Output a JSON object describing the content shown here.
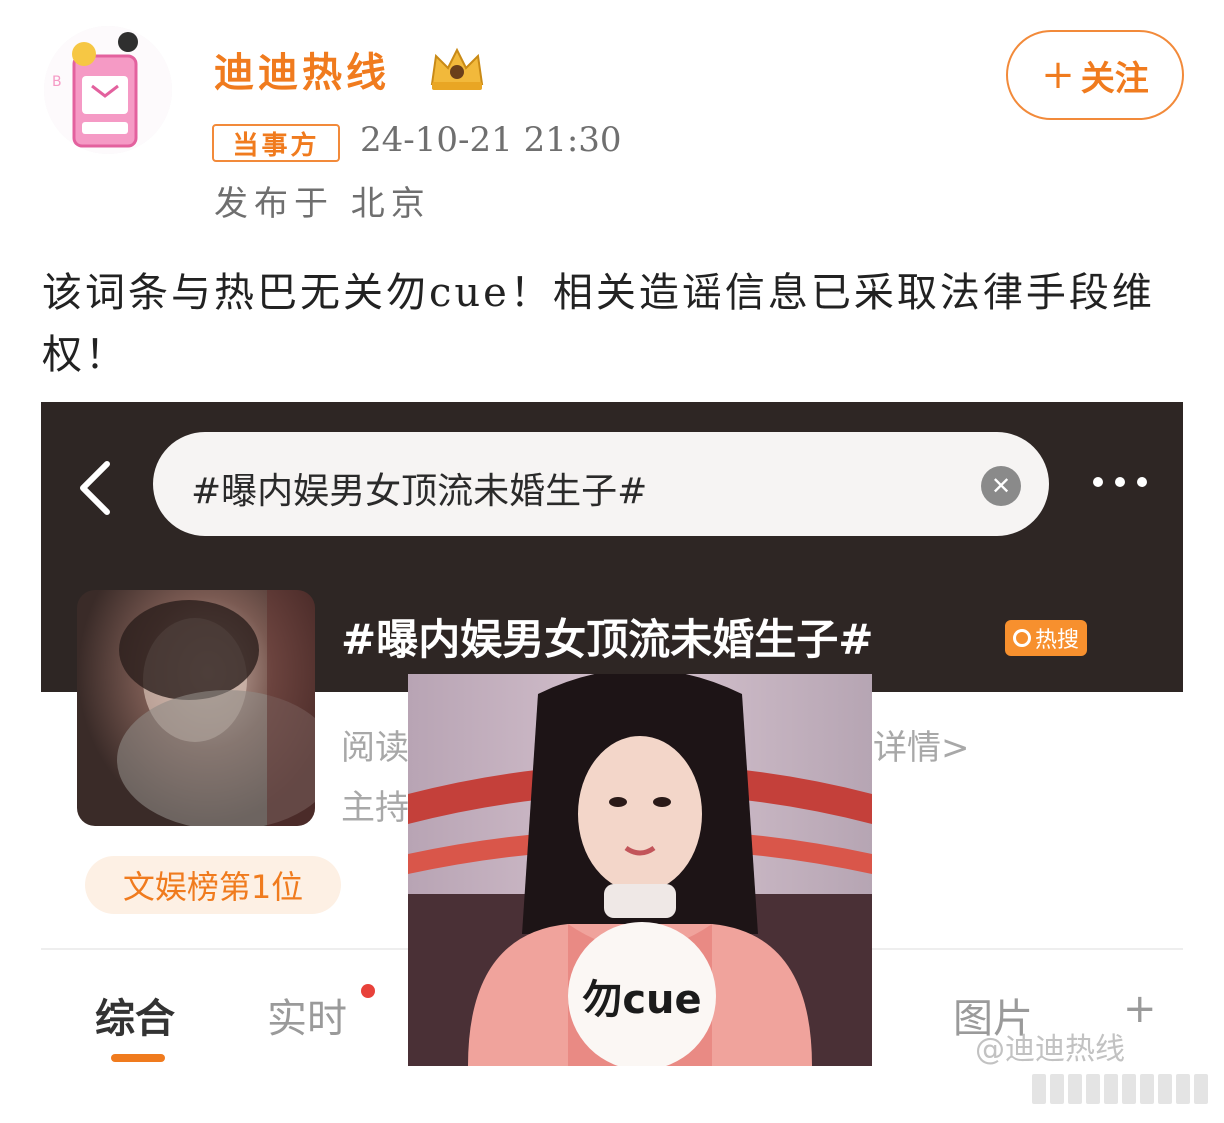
{
  "post": {
    "author": "迪迪热线",
    "follow_label": "关注",
    "role_badge": "当事方",
    "time": "24-10-21 21:30",
    "location": "发布于 北京",
    "text": "该词条与热巴无关勿cue！相关造谣信息已采取法律手段维权！"
  },
  "embedded": {
    "search_query": "#曝内娱男女顶流未婚生子#",
    "topic_title": "#曝内娱男女顶流未婚生子#",
    "hot_badge": "热搜",
    "read_label": "阅读",
    "detail_label": "详情>",
    "host_label": "主持",
    "rank_badge": "文娱榜第1位",
    "tabs": [
      "综合",
      "实时",
      "图片"
    ],
    "more_tab": "+",
    "watermark": "@迪迪热线"
  },
  "meme": {
    "caption": "勿cue"
  },
  "colors": {
    "accent": "#f07b1e",
    "dark_header": "#2e2624",
    "hot_badge": "#f7902e"
  },
  "icons": [
    "back-arrow-icon",
    "clear-icon",
    "more-icon",
    "crown-badge-icon",
    "plus-icon"
  ]
}
